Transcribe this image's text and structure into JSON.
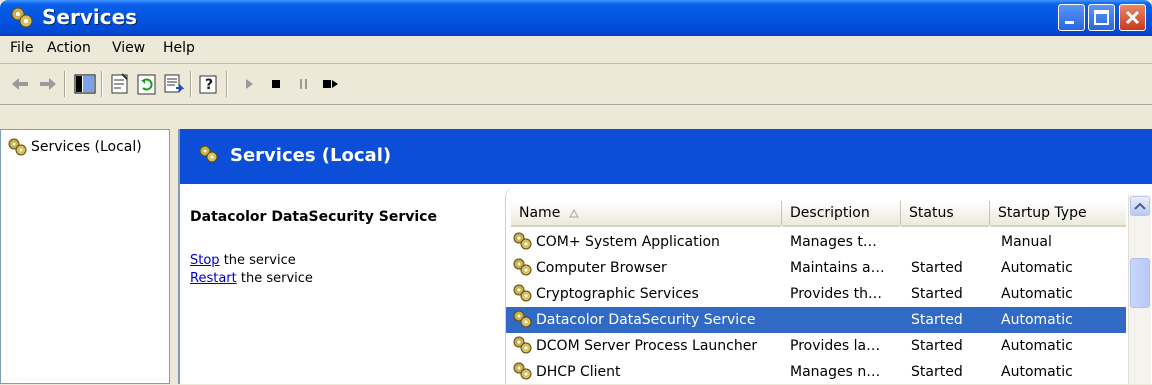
{
  "window": {
    "title": "Services",
    "colors": {
      "titlebar": "#0355e1",
      "banner": "#0d4ed8",
      "selection": "#316ac5",
      "link": "#0000cc"
    }
  },
  "menu": {
    "items": [
      "File",
      "Action",
      "View",
      "Help"
    ]
  },
  "toolbar": {
    "icons": [
      "back-arrow-icon",
      "forward-arrow-icon",
      "show-hide-console-tree-icon",
      "properties-icon",
      "refresh-icon",
      "export-list-icon",
      "help-icon",
      "start-service-icon",
      "stop-service-icon",
      "pause-service-icon",
      "restart-service-icon"
    ]
  },
  "tree": {
    "root_label": "Services (Local)"
  },
  "banner": {
    "title": "Services (Local)"
  },
  "detail": {
    "service_name": "Datacolor DataSecurity Service",
    "stop_link": "Stop",
    "stop_text": " the service",
    "restart_link": "Restart",
    "restart_text": " the service"
  },
  "list": {
    "columns": [
      "Name",
      "Description",
      "Status",
      "Startup Type"
    ],
    "rows": [
      {
        "name": "COM+ System Application",
        "description": "Manages t…",
        "status": "",
        "startup": "Manual",
        "selected": false
      },
      {
        "name": "Computer Browser",
        "description": "Maintains a…",
        "status": "Started",
        "startup": "Automatic",
        "selected": false
      },
      {
        "name": "Cryptographic Services",
        "description": "Provides th…",
        "status": "Started",
        "startup": "Automatic",
        "selected": false
      },
      {
        "name": "Datacolor DataSecurity Service",
        "description": "",
        "status": "Started",
        "startup": "Automatic",
        "selected": true
      },
      {
        "name": "DCOM Server Process Launcher",
        "description": "Provides la…",
        "status": "Started",
        "startup": "Automatic",
        "selected": false
      },
      {
        "name": "DHCP Client",
        "description": "Manages n…",
        "status": "Started",
        "startup": "Automatic",
        "selected": false
      }
    ]
  }
}
